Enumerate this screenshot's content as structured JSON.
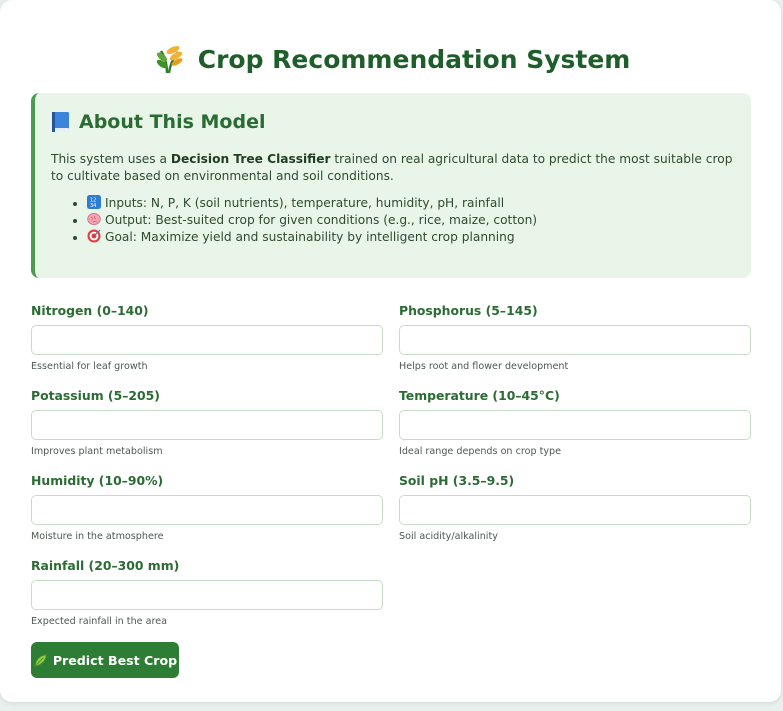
{
  "header": {
    "title": "Crop Recommendation System",
    "icon": "crop-wheat-icon"
  },
  "about": {
    "title": "About This Model",
    "icon": "book-icon",
    "intro_before": "This system uses a ",
    "intro_bold": "Decision Tree Classifier",
    "intro_after": " trained on real agricultural data to predict the most suitable crop to cultivate based on environmental and soil conditions.",
    "items": [
      {
        "icon": "numbers-icon",
        "text": "Inputs: N, P, K (soil nutrients), temperature, humidity, pH, rainfall"
      },
      {
        "icon": "brain-icon",
        "text": "Output: Best-suited crop for given conditions (e.g., rice, maize, cotton)"
      },
      {
        "icon": "target-icon",
        "text": "Goal: Maximize yield and sustainability by intelligent crop planning"
      }
    ]
  },
  "form": {
    "fields": [
      {
        "label": "Nitrogen (0–140)",
        "hint": "Essential for leaf growth",
        "value": ""
      },
      {
        "label": "Phosphorus (5–145)",
        "hint": "Helps root and flower development",
        "value": ""
      },
      {
        "label": "Potassium (5–205)",
        "hint": "Improves plant metabolism",
        "value": ""
      },
      {
        "label": "Temperature (10–45°C)",
        "hint": "Ideal range depends on crop type",
        "value": ""
      },
      {
        "label": "Humidity (10–90%)",
        "hint": "Moisture in the atmosphere",
        "value": ""
      },
      {
        "label": "Soil pH (3.5–9.5)",
        "hint": "Soil acidity/alkalinity",
        "value": ""
      },
      {
        "label": "Rainfall (20–300 mm)",
        "hint": "Expected rainfall in the area",
        "value": ""
      }
    ],
    "submit_label": "Predict Best Crop",
    "submit_icon": "leaf-icon"
  },
  "colors": {
    "primary": "#2e7d35",
    "heading": "#1e5e2b",
    "about_bg": "#e9f5e8",
    "about_border": "#4d9a52",
    "page_bg": "#e8f1ee"
  }
}
